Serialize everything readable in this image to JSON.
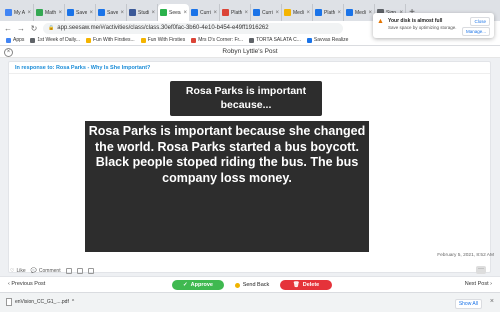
{
  "browser": {
    "tabs": [
      {
        "label": "My A",
        "color": "#4285f4"
      },
      {
        "label": "Math",
        "color": "#34a853"
      },
      {
        "label": "Saves",
        "color": "#1a73e8"
      },
      {
        "label": "Saves",
        "color": "#1a73e8"
      },
      {
        "label": "Studio",
        "color": "#3b5998"
      },
      {
        "label": "Seesa",
        "color": "#2bb24c",
        "active": true
      },
      {
        "label": "Curric",
        "color": "#1a73e8"
      },
      {
        "label": "Platfo",
        "color": "#db4437"
      },
      {
        "label": "Curric",
        "color": "#1a73e8"
      },
      {
        "label": "Media",
        "color": "#f4b400"
      },
      {
        "label": "Platfo",
        "color": "#1a73e8"
      },
      {
        "label": "Media",
        "color": "#1a73e8"
      },
      {
        "label": "Sign",
        "color": "#5f6368"
      }
    ],
    "url": "app.seesaw.me/#/activities/class/class.30ef0fac-3b60-4e10-b454-e49ff1916262",
    "bookmarks": [
      {
        "label": "Apps",
        "color": "#4285f4"
      },
      {
        "label": "1st Week of Daily...",
        "color": "#5f6368"
      },
      {
        "label": "Fun With Firsties...",
        "color": "#f4b400"
      },
      {
        "label": "Fun With Firsties",
        "color": "#f4b400"
      },
      {
        "label": "Mrs D's Corner: Fr...",
        "color": "#db4437"
      },
      {
        "label": "TORTA SALATA C...",
        "color": "#5f6368"
      },
      {
        "label": "Savvas Realize",
        "color": "#1a73e8"
      }
    ],
    "popup": {
      "title": "Your disk is almost full",
      "subtitle": "Save space by optimizing storage.",
      "close_label": "Close",
      "manage_label": "Manage..."
    }
  },
  "post": {
    "header_title": "Robyn Lyttle's Post",
    "in_response": "In response to: Rosa Parks - Why Is She Important?",
    "note_small": "Rosa Parks is important because...",
    "note_large": "Rosa Parks is important because she changed the world. Rosa Parks started a bus boycott. Black people stoped riding the bus. The bus company loss money.",
    "timestamp": "February 5, 2021, 8:52 AM",
    "like_label": "Like",
    "comment_label": "Comment"
  },
  "actions": {
    "prev_label": "Previous Post",
    "next_label": "Next Post",
    "approve_label": "Approve",
    "sendback_label": "Send Back",
    "delete_label": "Delete"
  },
  "downloads": {
    "file_label": "enVision_CC_G1_....pdf",
    "show_all_label": "Show All"
  }
}
